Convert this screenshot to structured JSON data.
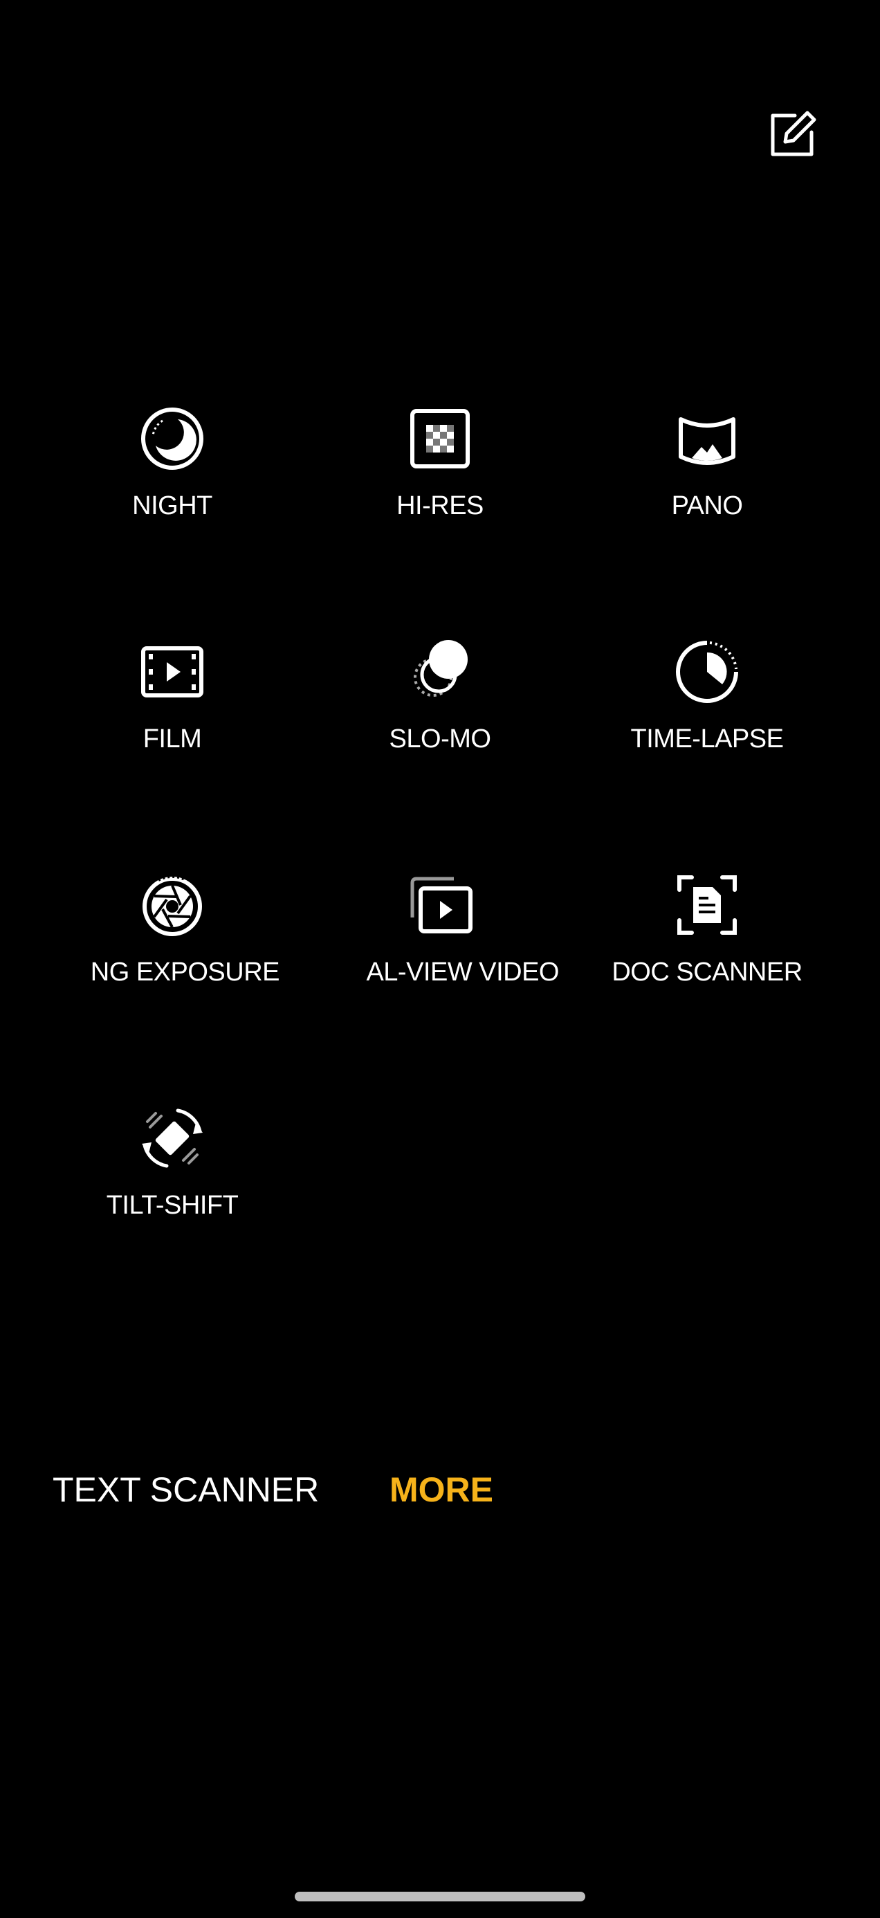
{
  "header": {
    "edit_icon": "edit-square-pencil-icon"
  },
  "modes": [
    {
      "id": "night",
      "label": "NIGHT",
      "icon": "moon-icon"
    },
    {
      "id": "hi-res",
      "label": "HI-RES",
      "icon": "checker-grid-icon"
    },
    {
      "id": "pano",
      "label": "PANO",
      "icon": "panorama-icon"
    },
    {
      "id": "film",
      "label": "FILM",
      "icon": "film-play-icon"
    },
    {
      "id": "slo-mo",
      "label": "SLO-MO",
      "icon": "slow-motion-icon"
    },
    {
      "id": "time-lapse",
      "label": "TIME-LAPSE",
      "icon": "time-lapse-icon"
    },
    {
      "id": "long-exposure",
      "label": "NG EXPOSURE",
      "icon": "aperture-icon"
    },
    {
      "id": "dual-view-video",
      "label": "AL-VIEW VIDEO",
      "icon": "dual-view-video-icon"
    },
    {
      "id": "doc-scanner",
      "label": "DOC SCANNER",
      "icon": "document-scan-icon"
    },
    {
      "id": "tilt-shift",
      "label": "TILT-SHIFT",
      "icon": "tilt-shift-icon"
    }
  ],
  "bottom_tabs": {
    "text_scanner": "TEXT SCANNER",
    "more": "MORE"
  },
  "colors": {
    "background": "#000000",
    "text": "#ffffff",
    "accent": "#f6b21a"
  }
}
